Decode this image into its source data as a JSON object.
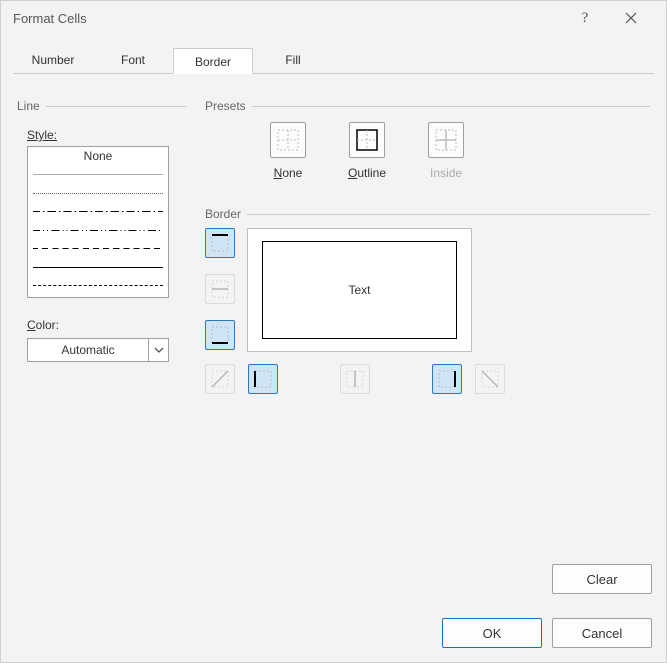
{
  "window": {
    "title": "Format Cells"
  },
  "tabs": [
    "Number",
    "Font",
    "Border",
    "Fill"
  ],
  "activeTab": "Border",
  "line": {
    "legend": "Line",
    "style_label": "Style:",
    "none": "None",
    "color_label": "Color:",
    "color_text": "Automatic"
  },
  "presets": {
    "legend": "Presets",
    "items": {
      "none": "None",
      "outline": "Outline",
      "inside": "Inside"
    }
  },
  "border": {
    "legend": "Border",
    "preview_text": "Text"
  },
  "buttons": {
    "clear": "Clear",
    "ok": "OK",
    "cancel": "Cancel"
  },
  "toolbuttons": {
    "side": {
      "top": true,
      "mid": false,
      "bottom": true
    },
    "bottom": {
      "diag1": false,
      "left": true,
      "center": false,
      "right": true,
      "diag2": false
    }
  }
}
